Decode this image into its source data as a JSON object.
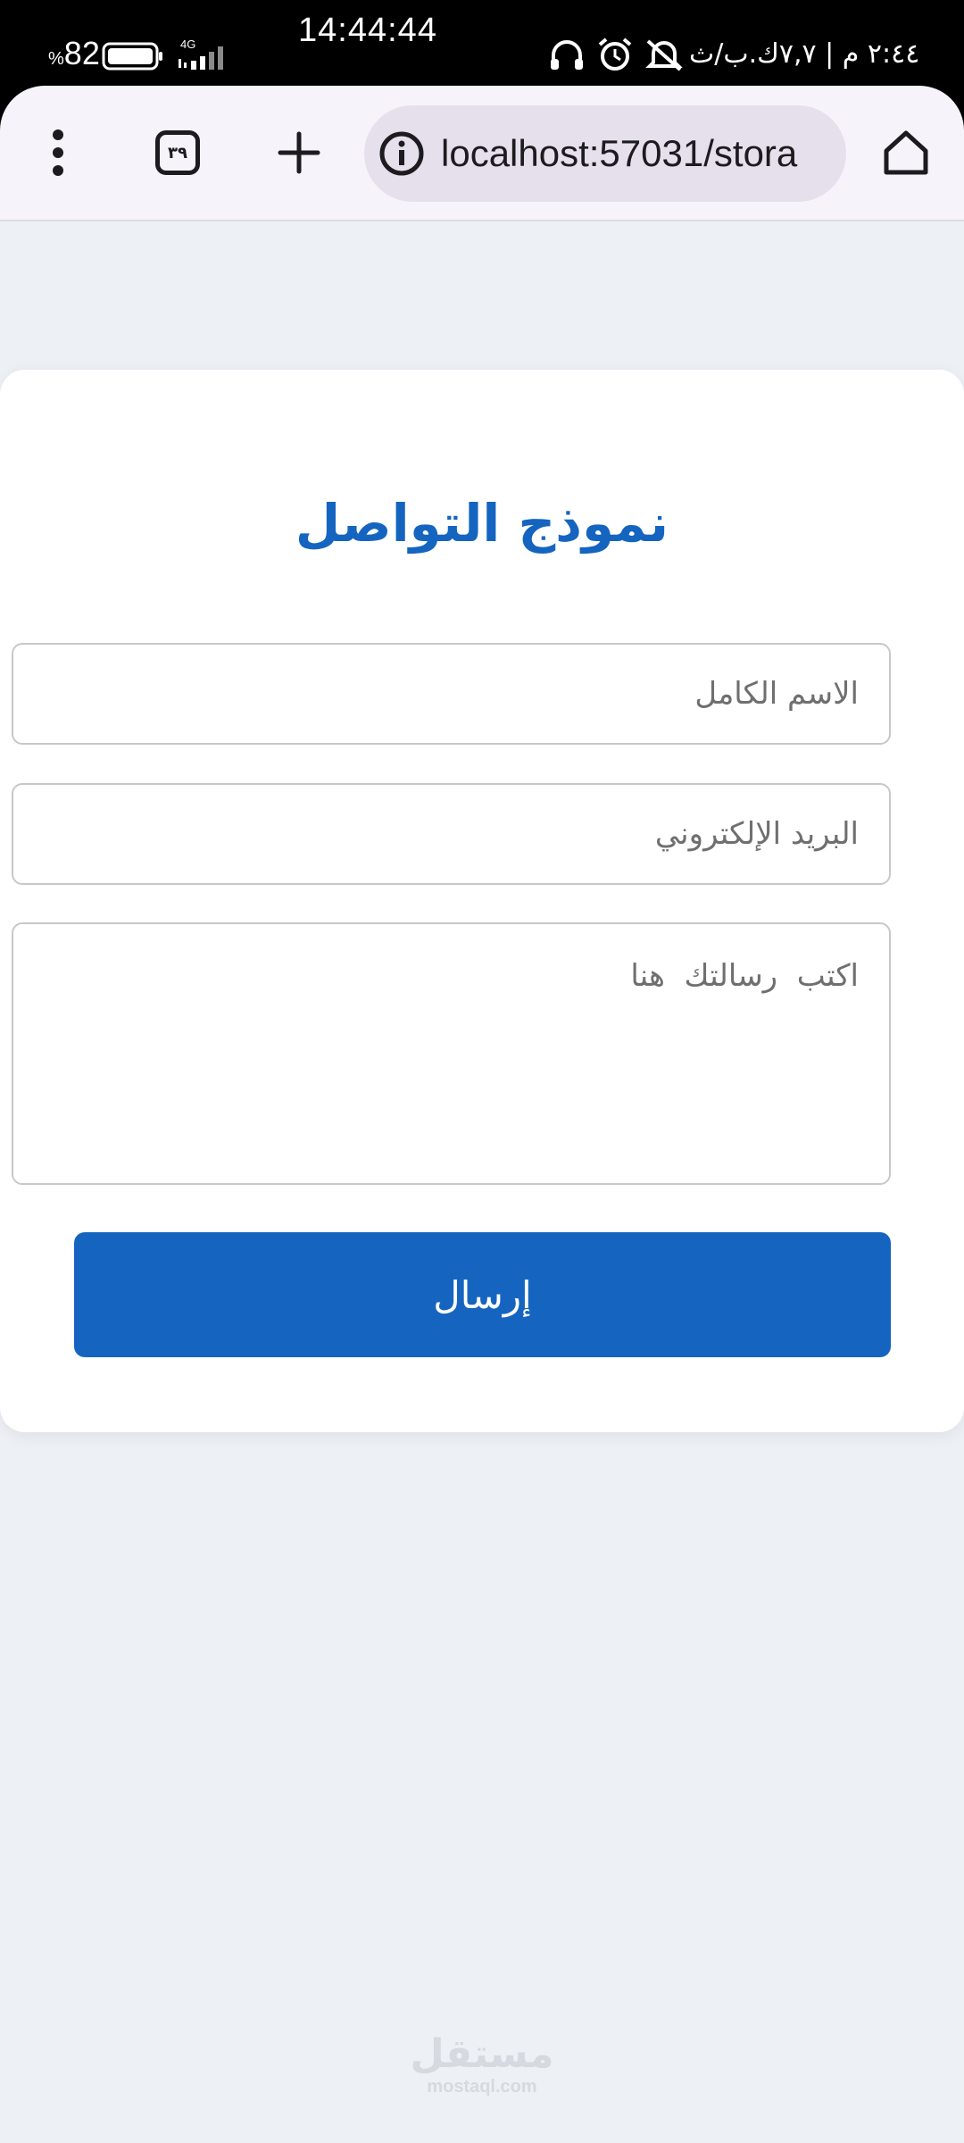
{
  "status_bar": {
    "battery_percent": "82",
    "percent_sign": "%",
    "network_type": "4G",
    "time": "14:44:44",
    "right_text": "٢:٤٤ م | ٧,٧ك.ب/ث",
    "icons": [
      "battery-icon",
      "signal-icon",
      "headset-icon",
      "alarm-icon",
      "mute-icon"
    ]
  },
  "browser": {
    "url": "localhost:57031/stora",
    "tab_count": "٣٩",
    "icons": [
      "more-vert-icon",
      "tabs-icon",
      "plus-icon",
      "info-icon",
      "home-icon"
    ]
  },
  "form": {
    "title": "نموذج التواصل",
    "name_placeholder": "الاسم الكامل",
    "email_placeholder": "البريد الإلكتروني",
    "message_placeholder": "اكتب  رسالتك  هنا",
    "submit_label": "إرسال"
  },
  "watermark": {
    "main": "مستقل",
    "sub": "mostaql.com"
  },
  "colors": {
    "accent": "#1565c0",
    "page_background": "#edf0f5",
    "card_background": "#ffffff",
    "toolbar_background": "#f7f3fb",
    "url_bar_background": "#e6e0ec"
  }
}
